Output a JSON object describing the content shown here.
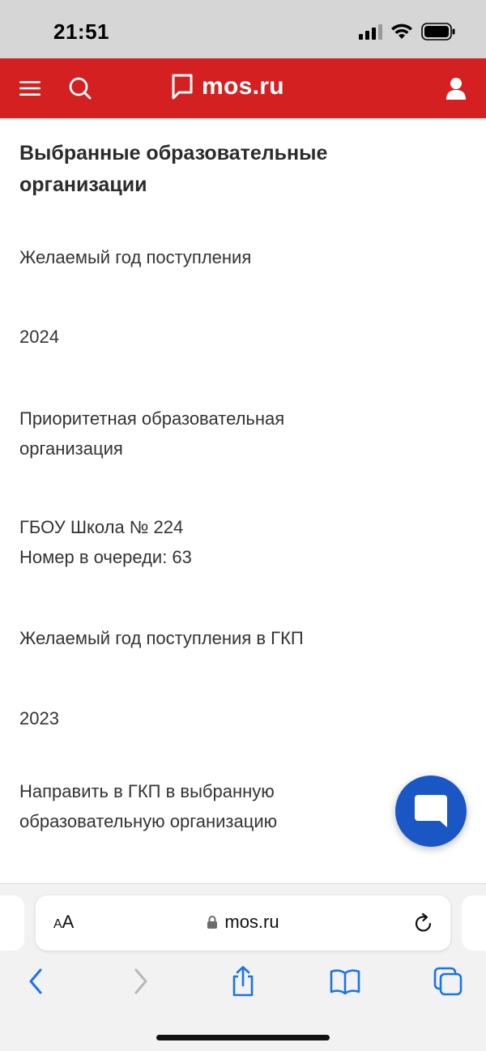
{
  "status_bar": {
    "time": "21:51"
  },
  "header": {
    "logo_text": "mos.ru",
    "brand_color": "#d42020",
    "icons": [
      "menu-icon",
      "search-icon",
      "logo-icon",
      "user-icon"
    ]
  },
  "main": {
    "title": "Выбранные образовательные организации",
    "fields": [
      {
        "label": "Желаемый год поступления",
        "value": "2024"
      },
      {
        "label": "Приоритетная образовательная организация",
        "value_line1": "ГБОУ Школа № 224",
        "value_line2": "Номер в очереди: 63"
      },
      {
        "label": "Желаемый год поступления в ГКП",
        "value": "2023"
      },
      {
        "label": "Направить в ГКП в выбранную образовательную организацию"
      }
    ]
  },
  "chat_button": {
    "icon": "chat-icon",
    "color": "#1a56c4"
  },
  "browser": {
    "aa_small": "A",
    "aa_large": "A",
    "url": "mos.ru",
    "icons": [
      "lock-icon",
      "reload-icon",
      "back-icon",
      "forward-icon",
      "share-icon",
      "bookmarks-icon",
      "tabs-icon"
    ]
  }
}
